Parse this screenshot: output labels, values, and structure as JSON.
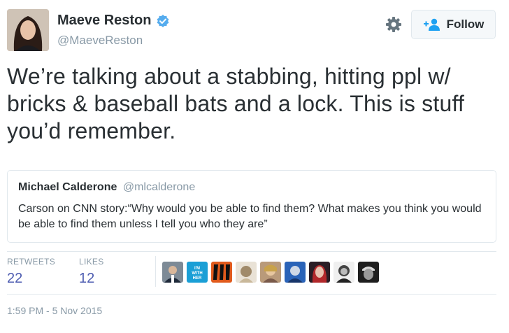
{
  "author": {
    "name": "Maeve Reston",
    "handle": "@MaeveReston",
    "verified": true
  },
  "follow_button": {
    "label": "Follow",
    "icon": "add-user-icon"
  },
  "settings_icon": "gear-icon",
  "tweet": {
    "text": "We’re talking about a stabbing, hitting ppl w/ bricks & baseball bats and a lock. This is stuff you’d remember."
  },
  "quoted_tweet": {
    "name": "Michael Calderone",
    "handle": "@mlcalderone",
    "text": "Carson on CNN story:“Why would you be able to find them? What makes you think you would be able to find them unless I tell you who they are”"
  },
  "stats": {
    "retweets_label": "RETWEETS",
    "retweets_value": "22",
    "likes_label": "LIKES",
    "likes_value": "12"
  },
  "likers": [
    {
      "name": "liker-avatar-1"
    },
    {
      "name": "liker-avatar-2",
      "text": "I'M WITH HER"
    },
    {
      "name": "liker-avatar-3"
    },
    {
      "name": "liker-avatar-4"
    },
    {
      "name": "liker-avatar-5"
    },
    {
      "name": "liker-avatar-6"
    },
    {
      "name": "liker-avatar-7"
    },
    {
      "name": "liker-avatar-8"
    },
    {
      "name": "liker-avatar-9"
    }
  ],
  "timestamp": "1:59 PM - 5 Nov 2015",
  "colors": {
    "verified_blue": "#1da1f2",
    "stat_value": "#4c5bb0",
    "muted": "#8899a6",
    "border": "#e1e8ed"
  }
}
